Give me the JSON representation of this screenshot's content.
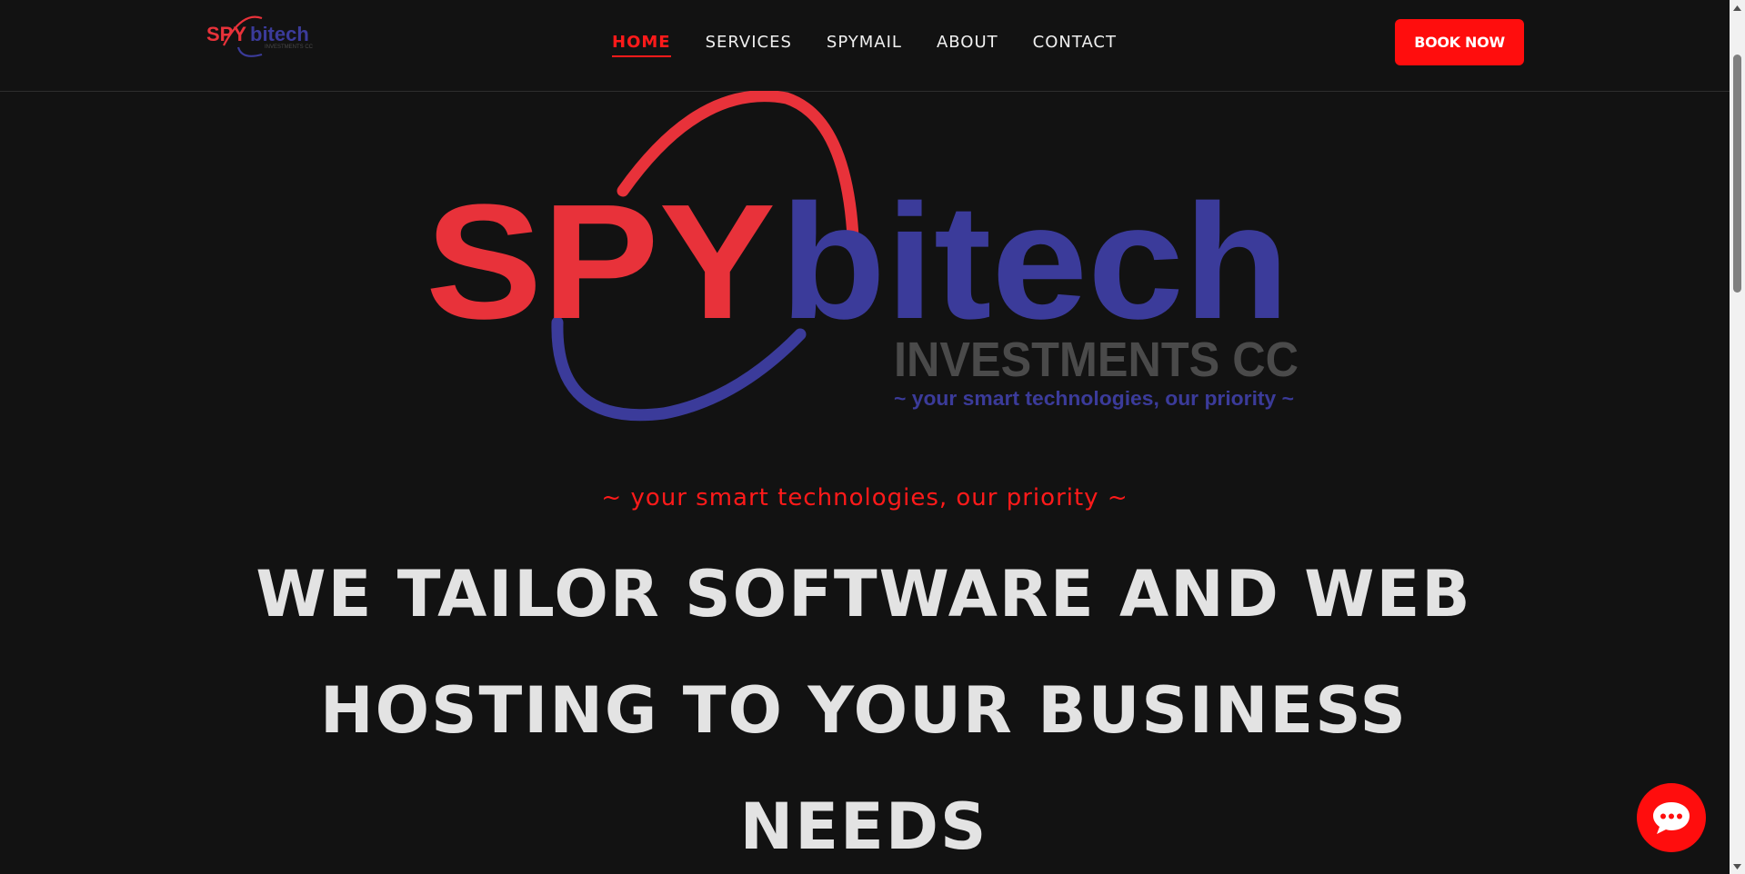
{
  "header": {
    "logo": {
      "brand_red": "SPY",
      "brand_blue": "bitech",
      "sub": "INVESTMENTS CC"
    },
    "nav": [
      {
        "label": "HOME",
        "active": true
      },
      {
        "label": "SERVICES",
        "active": false
      },
      {
        "label": "SPYMAIL",
        "active": false
      },
      {
        "label": "ABOUT",
        "active": false
      },
      {
        "label": "CONTACT",
        "active": false
      }
    ],
    "cta_label": "BOOK NOW"
  },
  "hero": {
    "logo": {
      "brand_red": "SPY",
      "brand_blue": "bitech",
      "sub": "INVESTMENTS CC",
      "slogan": "~ your smart technologies, our priority ~"
    },
    "tagline": "~ your smart technologies, our priority ~",
    "headline": "WE TAILOR SOFTWARE AND WEB HOSTING TO YOUR BUSINESS NEEDS"
  },
  "chat": {
    "icon": "chat-bubble-icon"
  },
  "colors": {
    "background": "#121212",
    "accent_red": "#ff0d0d",
    "brand_red": "#e8323a",
    "brand_blue": "#3b3b9a",
    "logo_grey": "#4a4a4a",
    "headline": "#e3e3e3",
    "nav_text": "#f0f0f0"
  }
}
